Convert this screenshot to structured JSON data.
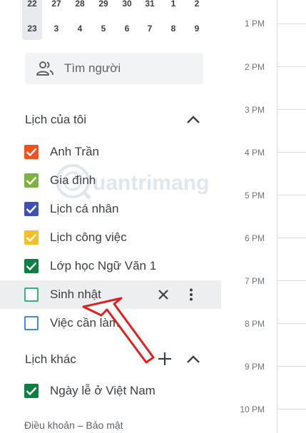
{
  "mini_calendar": {
    "row1": [
      "22",
      "27",
      "28",
      "29",
      "30",
      "31",
      "1",
      "2"
    ],
    "row2": [
      "23",
      "3",
      "4",
      "5",
      "6",
      "7",
      "8",
      "9"
    ]
  },
  "search_people": {
    "placeholder": "Tìm người",
    "icon": "people-icon"
  },
  "my_calendars": {
    "title": "Lịch của tôi",
    "items": [
      {
        "label": "Anh Trần",
        "color": "#f4511e",
        "checked": true
      },
      {
        "label": "Gia đình",
        "color": "#7cb342",
        "checked": true
      },
      {
        "label": "Lịch cá nhân",
        "color": "#3f51b5",
        "checked": true
      },
      {
        "label": "Lịch công việc",
        "color": "#f6bf26",
        "checked": true
      },
      {
        "label": "Lớp học Ngữ Văn 1",
        "color": "#0b8043",
        "checked": true
      },
      {
        "label": "Sinh nhật",
        "color": "#33b679",
        "checked": false
      },
      {
        "label": "Việc cần làm",
        "color": "#4285f4",
        "checked": false
      }
    ]
  },
  "other_calendars": {
    "title": "Lịch khác",
    "items": [
      {
        "label": "Ngày lễ ở Việt Nam",
        "color": "#0b8043",
        "checked": true
      }
    ]
  },
  "footer": "Điều khoản – Bảo mật",
  "times": [
    "1 PM",
    "2 PM",
    "3 PM",
    "4 PM",
    "5 PM",
    "6 PM",
    "7 PM",
    "8 PM",
    "9 PM",
    "10 PM"
  ],
  "watermark": "uantrimang"
}
